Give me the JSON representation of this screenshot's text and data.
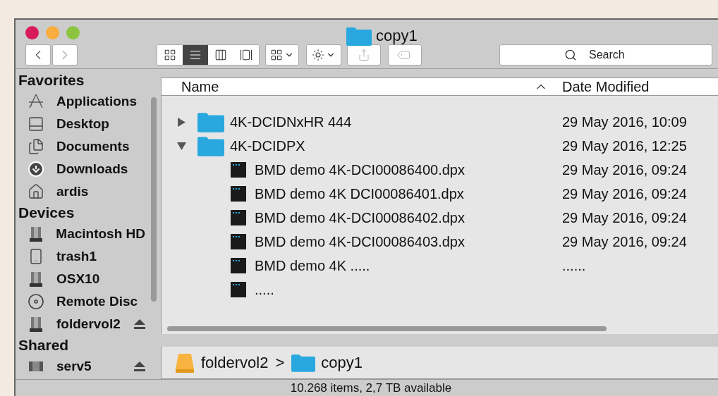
{
  "window": {
    "title": "copy1"
  },
  "toolbar": {
    "views": [
      {
        "kind": "icons",
        "selected": false
      },
      {
        "kind": "list",
        "selected": true
      },
      {
        "kind": "columns",
        "selected": false
      },
      {
        "kind": "gallery",
        "selected": false
      }
    ],
    "search": {
      "placeholder": "Search"
    }
  },
  "sidebar": {
    "sections": [
      {
        "title": "Favorites",
        "items": [
          {
            "name": "Applications",
            "kind": "apps",
            "ejectable": false
          },
          {
            "name": "Desktop",
            "kind": "desktop",
            "ejectable": false
          },
          {
            "name": "Documents",
            "kind": "documents",
            "ejectable": false
          },
          {
            "name": "Downloads",
            "kind": "downloads",
            "ejectable": false
          },
          {
            "name": "ardis",
            "kind": "home",
            "ejectable": false
          }
        ]
      },
      {
        "title": "Devices",
        "items": [
          {
            "name": "Macintosh HD",
            "kind": "drive",
            "ejectable": false
          },
          {
            "name": "trash1",
            "kind": "removable",
            "ejectable": false
          },
          {
            "name": "OSX10",
            "kind": "drive",
            "ejectable": false
          },
          {
            "name": "Remote Disc",
            "kind": "disc",
            "ejectable": false
          },
          {
            "name": "foldervol2",
            "kind": "drive",
            "ejectable": true
          }
        ]
      },
      {
        "title": "Shared",
        "items": [
          {
            "name": "serv5",
            "kind": "server",
            "ejectable": true
          }
        ]
      }
    ]
  },
  "table": {
    "columns": [
      "Name",
      "Date Modified"
    ],
    "rows": [
      {
        "name": "4K-DCIDNxHR 444",
        "date": "29 May 2016, 10:09",
        "kind": "folder",
        "expanded": false
      },
      {
        "name": "4K-DCIDPX",
        "date": "29 May 2016, 12:25",
        "kind": "folder",
        "expanded": true,
        "children": [
          {
            "name": "BMD demo 4K-DCI00086400.dpx",
            "date": "29 May 2016, 09:24",
            "kind": "file"
          },
          {
            "name": "BMD demo 4K DCI00086401.dpx",
            "date": "29 May 2016, 09:24",
            "kind": "file"
          },
          {
            "name": "BMD demo 4K-DCI00086402.dpx",
            "date": "29 May 2016, 09:24",
            "kind": "file"
          },
          {
            "name": "BMD demo 4K-DCI00086403.dpx",
            "date": "29 May 2016, 09:24",
            "kind": "file"
          },
          {
            "name": "BMD demo 4K .....",
            "date": "......",
            "kind": "file"
          },
          {
            "name": ".....",
            "kind": "file"
          }
        ]
      }
    ]
  },
  "path_bar": {
    "separator": ">",
    "items": [
      {
        "name": "foldervol2",
        "kind": "drive"
      },
      {
        "name": "copy1",
        "kind": "folder"
      }
    ]
  },
  "status_bar": "10.268 items, 2,7 TB available"
}
